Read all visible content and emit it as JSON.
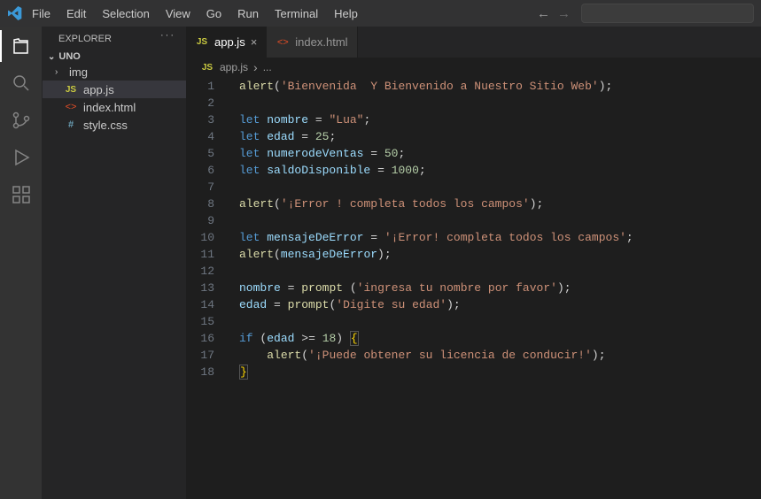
{
  "menu": {
    "items": [
      "File",
      "Edit",
      "Selection",
      "View",
      "Go",
      "Run",
      "Terminal",
      "Help"
    ]
  },
  "sidebar": {
    "title": "EXPLORER",
    "root": "UNO",
    "items": [
      {
        "kind": "folder",
        "name": "img",
        "glyph": "›"
      },
      {
        "kind": "file",
        "name": "app.js",
        "icon": "JS",
        "selected": true
      },
      {
        "kind": "file",
        "name": "index.html",
        "icon": "<>",
        "cls": "fi-html"
      },
      {
        "kind": "file",
        "name": "style.css",
        "icon": "#",
        "cls": "fi-css"
      }
    ]
  },
  "tabs": [
    {
      "name": "app.js",
      "icon": "JS",
      "active": true,
      "iconCls": "fi-js"
    },
    {
      "name": "index.html",
      "icon": "<>",
      "active": false,
      "iconCls": "fi-html"
    }
  ],
  "breadcrumb": {
    "icon": "JS",
    "file": "app.js",
    "sep": "›",
    "more": "..."
  },
  "code": {
    "lines": [
      [
        [
          "fn",
          "alert"
        ],
        [
          "punc",
          "("
        ],
        [
          "str",
          "'Bienvenida  Y Bienvenido a Nuestro Sitio Web'"
        ],
        [
          "punc",
          ");"
        ]
      ],
      [],
      [
        [
          "kw",
          "let"
        ],
        [
          "sp",
          " "
        ],
        [
          "var",
          "nombre"
        ],
        [
          "sp",
          " "
        ],
        [
          "op",
          "="
        ],
        [
          "sp",
          " "
        ],
        [
          "str",
          "\"Lua\""
        ],
        [
          "punc",
          ";"
        ]
      ],
      [
        [
          "kw",
          "let"
        ],
        [
          "sp",
          " "
        ],
        [
          "var",
          "edad"
        ],
        [
          "sp",
          " "
        ],
        [
          "op",
          "="
        ],
        [
          "sp",
          " "
        ],
        [
          "num",
          "25"
        ],
        [
          "punc",
          ";"
        ]
      ],
      [
        [
          "kw",
          "let"
        ],
        [
          "sp",
          " "
        ],
        [
          "var",
          "numerodeVentas"
        ],
        [
          "sp",
          " "
        ],
        [
          "op",
          "="
        ],
        [
          "sp",
          " "
        ],
        [
          "num",
          "50"
        ],
        [
          "punc",
          ";"
        ]
      ],
      [
        [
          "kw",
          "let"
        ],
        [
          "sp",
          " "
        ],
        [
          "var",
          "saldoDisponible"
        ],
        [
          "sp",
          " "
        ],
        [
          "op",
          "="
        ],
        [
          "sp",
          " "
        ],
        [
          "num",
          "1000"
        ],
        [
          "punc",
          ";"
        ]
      ],
      [],
      [
        [
          "fn",
          "alert"
        ],
        [
          "punc",
          "("
        ],
        [
          "str",
          "'¡Error ! completa todos los campos'"
        ],
        [
          "punc",
          ");"
        ]
      ],
      [],
      [
        [
          "kw",
          "let"
        ],
        [
          "sp",
          " "
        ],
        [
          "var",
          "mensajeDeError"
        ],
        [
          "sp",
          " "
        ],
        [
          "op",
          "="
        ],
        [
          "sp",
          " "
        ],
        [
          "str",
          "'¡Error! completa todos los campos'"
        ],
        [
          "punc",
          ";"
        ]
      ],
      [
        [
          "fn",
          "alert"
        ],
        [
          "punc",
          "("
        ],
        [
          "var",
          "mensajeDeError"
        ],
        [
          "punc",
          ");"
        ]
      ],
      [],
      [
        [
          "var",
          "nombre"
        ],
        [
          "sp",
          " "
        ],
        [
          "op",
          "="
        ],
        [
          "sp",
          " "
        ],
        [
          "fn",
          "prompt"
        ],
        [
          "sp",
          " "
        ],
        [
          "punc",
          "("
        ],
        [
          "str",
          "'ingresa tu nombre por favor'"
        ],
        [
          "punc",
          ");"
        ]
      ],
      [
        [
          "var",
          "edad"
        ],
        [
          "sp",
          " "
        ],
        [
          "op",
          "="
        ],
        [
          "sp",
          " "
        ],
        [
          "fn",
          "prompt"
        ],
        [
          "punc",
          "("
        ],
        [
          "str",
          "'Digite su edad'"
        ],
        [
          "punc",
          ");"
        ]
      ],
      [],
      [
        [
          "kw",
          "if"
        ],
        [
          "sp",
          " "
        ],
        [
          "punc",
          "("
        ],
        [
          "var",
          "edad"
        ],
        [
          "sp",
          " "
        ],
        [
          "op",
          ">="
        ],
        [
          "sp",
          " "
        ],
        [
          "num",
          "18"
        ],
        [
          "punc",
          ") "
        ],
        [
          "brh",
          "{"
        ]
      ],
      [
        [
          "sp",
          "    "
        ],
        [
          "fn",
          "alert"
        ],
        [
          "punc",
          "("
        ],
        [
          "str",
          "'¡Puede obtener su licencia de conducir!'"
        ],
        [
          "punc",
          ");"
        ]
      ],
      [
        [
          "brh",
          "}"
        ]
      ]
    ]
  }
}
